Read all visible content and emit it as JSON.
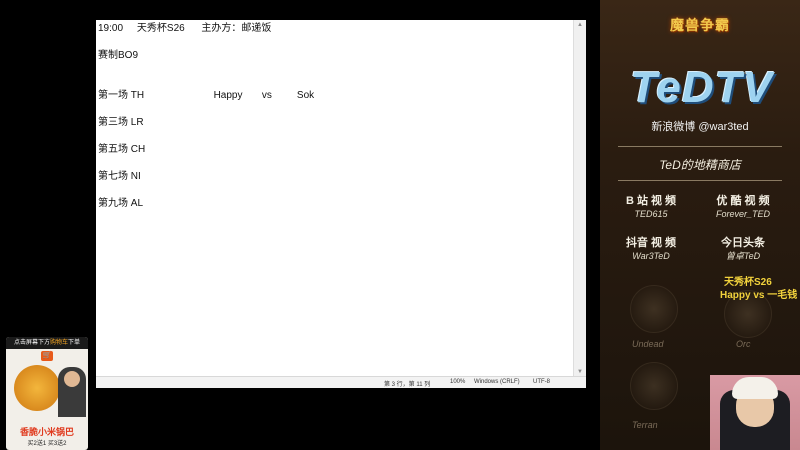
{
  "notepad": {
    "lines": [
      "19:00     天秀杯S26      主办方：邮递饭",
      "赛制BO9",
      "第一场 TH                         Happy       vs         Sok",
      "第三场 LR",
      "第五场 CH",
      "第七场 NI",
      "第九场 AL"
    ],
    "status": {
      "position": "第 3 行，第 11 列",
      "zoom": "100%",
      "line_ending": "Windows (CRLF)",
      "encoding": "UTF-8"
    }
  },
  "panel": {
    "game_logo": "魔兽争霸",
    "brand": "TeDTV",
    "weibo": "新浪微博 @war3ted",
    "shop": "TeD的地精商店",
    "socials": [
      {
        "platform": "B 站 视 频",
        "handle": "TED615"
      },
      {
        "platform": "优 酷 视 频",
        "handle": "Forever_TED"
      },
      {
        "platform": "抖音 视 频",
        "handle": "War3TeD"
      },
      {
        "platform": "今日头条",
        "handle": "曾卓TeD"
      }
    ],
    "races": [
      "Undead",
      "Orc",
      "Terran"
    ],
    "ticker": {
      "line1": "天秀杯S26",
      "line2": "Happy vs 一毛钱"
    }
  },
  "ad": {
    "top_text_a": "点击屏幕下方",
    "top_text_b": "购物车",
    "top_text_c": "下单",
    "title": "香脆小米锅巴",
    "deal": "买2送1 买3送2"
  }
}
